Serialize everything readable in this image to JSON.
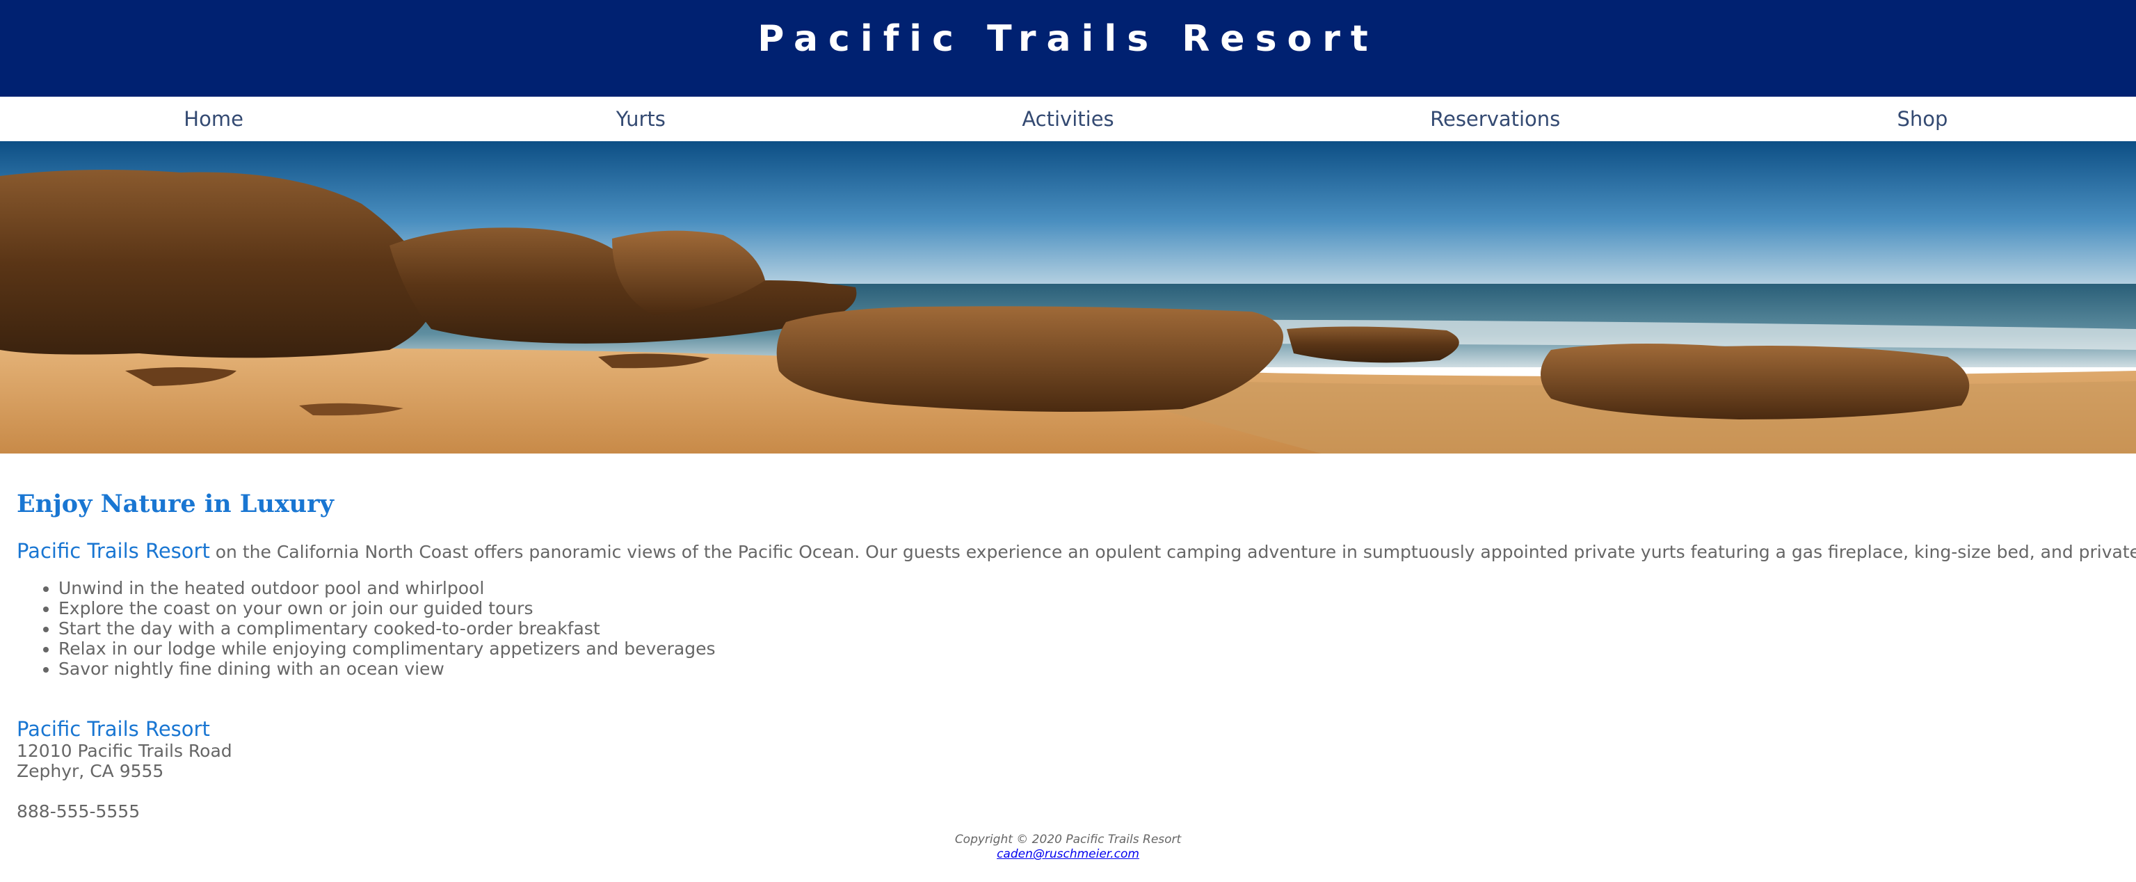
{
  "header": {
    "title": "Pacific Trails Resort"
  },
  "nav": {
    "items": [
      "Home",
      "Yurts",
      "Activities",
      "Reservations",
      "Shop"
    ]
  },
  "hero": {
    "image": "coastal-rocks-beach-photo"
  },
  "main": {
    "heading": "Enjoy Nature in Luxury",
    "intro_brand": "Pacific Trails Resort",
    "intro_text": " on the California North Coast offers panoramic views of the Pacific Ocean. Our guests experience an opulent camping adventure in sumptuously appointed private yurts featuring a gas fireplace, king-size bed, and private deck.",
    "features": [
      "Unwind in the heated outdoor pool and whirlpool",
      "Explore the coast on your own or join our guided tours",
      "Start the day with a complimentary cooked-to-order breakfast",
      "Relax in our lodge while enjoying complimentary appetizers and beverages",
      "Savor nightly fine dining with an ocean view"
    ]
  },
  "contact": {
    "name": "Pacific Trails Resort",
    "street": "12010 Pacific Trails Road",
    "city": "Zephyr, CA 9555",
    "phone": "888-555-5555"
  },
  "footer": {
    "copyright": "Copyright © 2020 Pacific Trails Resort",
    "email": "caden@ruschmeier.com"
  },
  "colors": {
    "header_bg": "#002171",
    "accent": "#1976d2",
    "nav_text": "#344a72",
    "body_text": "#666666"
  }
}
